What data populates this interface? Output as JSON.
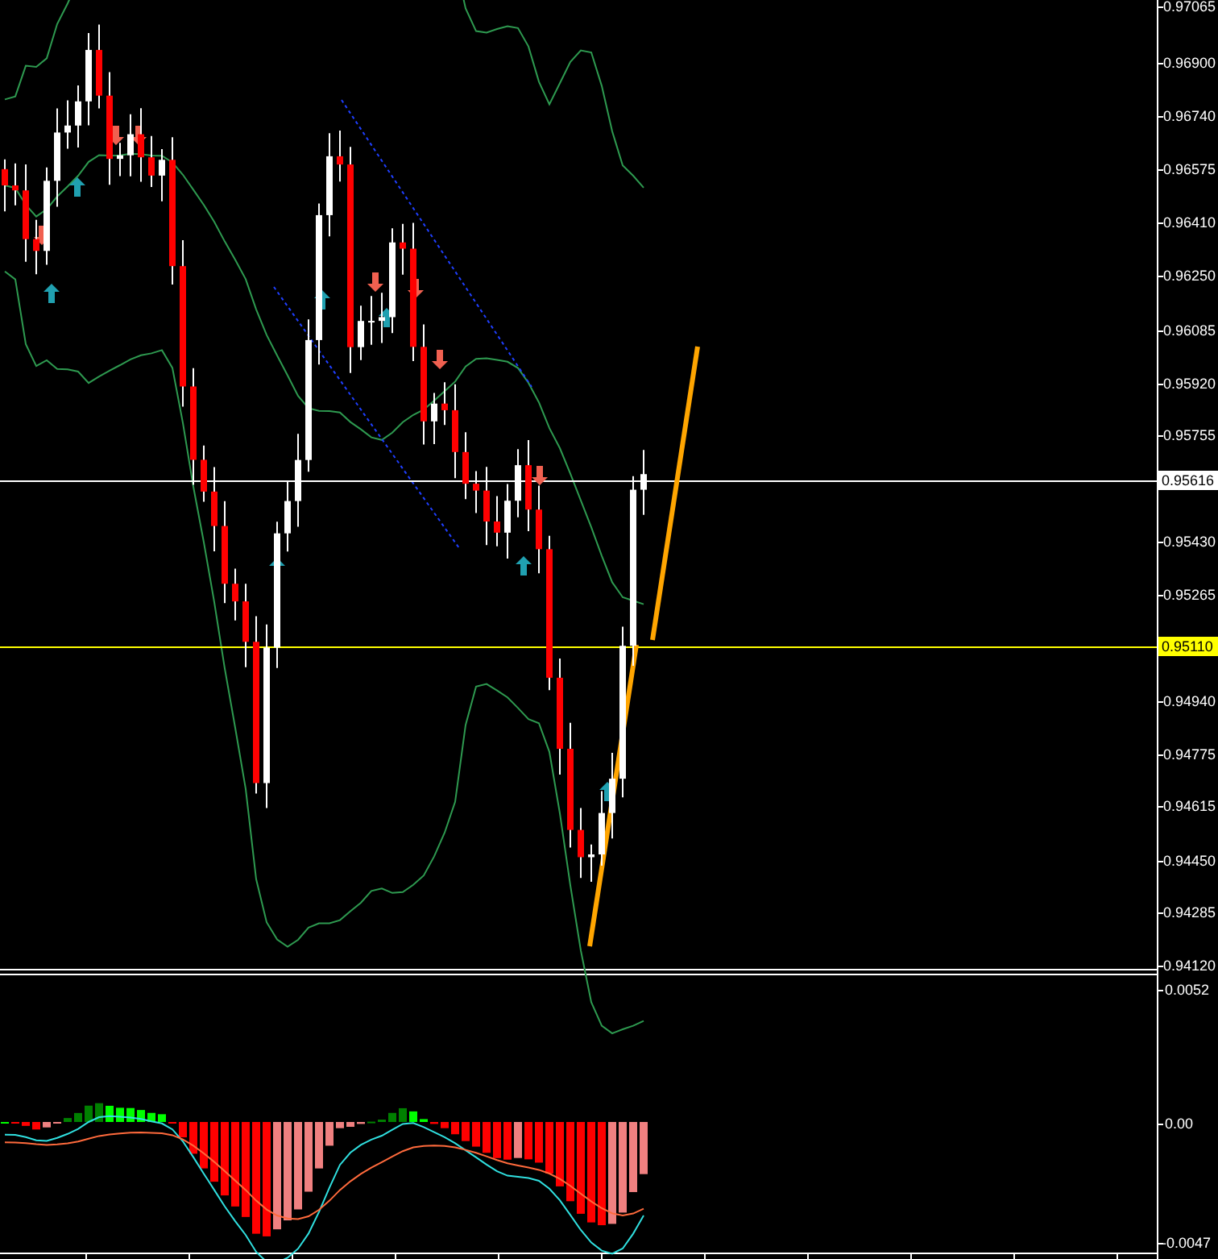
{
  "price_scale": {
    "ticks": [
      "0.97065",
      "0.96900",
      "0.96740",
      "0.96575",
      "0.96410",
      "0.96250",
      "0.96085",
      "0.95920",
      "0.95755",
      "0.95430",
      "0.95265",
      "0.94940",
      "0.94775",
      "0.94615",
      "0.94450",
      "0.94285",
      "0.94120"
    ]
  },
  "markers": [
    {
      "kind": "bid",
      "label": "0.95616",
      "color": "#ffffff"
    },
    {
      "kind": "level",
      "label": "0.95110",
      "color": "#ffff00"
    }
  ],
  "indicator_scale": {
    "ticks": [
      "0.0052",
      "0.00",
      "-0.0047"
    ]
  }
}
